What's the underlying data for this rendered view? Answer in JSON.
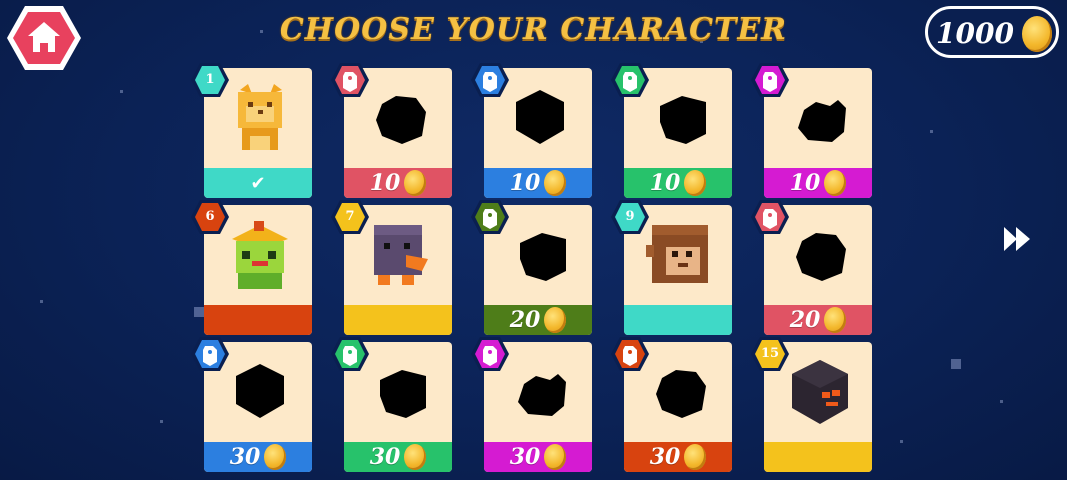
{
  "header": {
    "title": "CHOOSE YOUR CHARACTER"
  },
  "wallet": {
    "coins": "1000",
    "coin_icon": "coin-icon"
  },
  "nav": {
    "home_icon": "home-icon",
    "next_icon": "fast-forward-icon"
  },
  "colors": {
    "bg": "#0b2256",
    "card": "#fde9c9",
    "title": "#f5c043",
    "teal": "#3fd9c7",
    "red": "#e05364",
    "blue": "#2c7fe0",
    "green": "#27c26b",
    "magenta": "#d51bd2",
    "orange": "#d8430f",
    "yellow": "#f4c21c",
    "olive": "#4e7d19"
  },
  "characters": [
    {
      "badge": "1",
      "badge_color": "#3fd9c7",
      "bar_color": "#3fd9c7",
      "price": "",
      "state": "selected",
      "char": "cat"
    },
    {
      "badge": "",
      "badge_color": "#e05364",
      "bar_color": "#e05364",
      "price": "10",
      "state": "locked",
      "char": "silhouette"
    },
    {
      "badge": "",
      "badge_color": "#2c7fe0",
      "bar_color": "#2c7fe0",
      "price": "10",
      "state": "locked",
      "char": "silhouette"
    },
    {
      "badge": "",
      "badge_color": "#27c26b",
      "bar_color": "#27c26b",
      "price": "10",
      "state": "locked",
      "char": "silhouette"
    },
    {
      "badge": "",
      "badge_color": "#d51bd2",
      "bar_color": "#d51bd2",
      "price": "10",
      "state": "locked",
      "char": "silhouette"
    },
    {
      "badge": "6",
      "badge_color": "#d8430f",
      "bar_color": "#d8430f",
      "price": "",
      "state": "owned",
      "char": "frog"
    },
    {
      "badge": "7",
      "badge_color": "#f4c21c",
      "bar_color": "#f4c21c",
      "price": "",
      "state": "owned",
      "char": "penguin"
    },
    {
      "badge": "",
      "badge_color": "#4e7d19",
      "bar_color": "#4e7d19",
      "price": "20",
      "state": "locked",
      "char": "silhouette"
    },
    {
      "badge": "9",
      "badge_color": "#3fd9c7",
      "bar_color": "#3fd9c7",
      "price": "",
      "state": "owned",
      "char": "monkey"
    },
    {
      "badge": "",
      "badge_color": "#e05364",
      "bar_color": "#e05364",
      "price": "20",
      "state": "locked",
      "char": "silhouette"
    },
    {
      "badge": "",
      "badge_color": "#2c7fe0",
      "bar_color": "#2c7fe0",
      "price": "30",
      "state": "locked",
      "char": "silhouette"
    },
    {
      "badge": "",
      "badge_color": "#27c26b",
      "bar_color": "#27c26b",
      "price": "30",
      "state": "locked",
      "char": "silhouette"
    },
    {
      "badge": "",
      "badge_color": "#d51bd2",
      "bar_color": "#d51bd2",
      "price": "30",
      "state": "locked",
      "char": "silhouette"
    },
    {
      "badge": "",
      "badge_color": "#d8430f",
      "bar_color": "#d8430f",
      "price": "30",
      "state": "locked",
      "char": "silhouette"
    },
    {
      "badge": "15",
      "badge_color": "#f4c21c",
      "bar_color": "#f4c21c",
      "price": "",
      "state": "owned",
      "char": "cube"
    }
  ]
}
